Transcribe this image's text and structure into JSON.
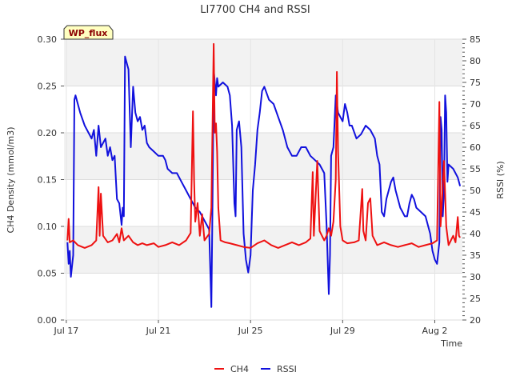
{
  "chart_data": {
    "type": "line",
    "title": "LI7700 CH4 and RSSI",
    "xlabel": "Time",
    "ylabel_left": "CH4 Density (mmol/m3)",
    "ylabel_right": "RSSI (%)",
    "badge": "WP_flux",
    "x_unit": "days since Jul 17",
    "xlim": [
      -0.1,
      17.2
    ],
    "ylim_left": [
      0.0,
      0.3
    ],
    "ylim_right": [
      20,
      85
    ],
    "x_ticks": [
      {
        "label": "Jul 17",
        "x": 0
      },
      {
        "label": "Jul 21",
        "x": 4
      },
      {
        "label": "Jul 25",
        "x": 8
      },
      {
        "label": "Jul 29",
        "x": 12
      },
      {
        "label": "Aug 2",
        "x": 16
      }
    ],
    "y_ticks_left": [
      "0.00",
      "0.05",
      "0.10",
      "0.15",
      "0.20",
      "0.25",
      "0.30"
    ],
    "y_ticks_right": [
      "20",
      "25",
      "30",
      "35",
      "40",
      "45",
      "50",
      "55",
      "60",
      "65",
      "70",
      "75",
      "80",
      "85"
    ],
    "legend": [
      {
        "name": "CH4",
        "color": "#ee1111"
      },
      {
        "name": "RSSI",
        "color": "#1111dd"
      }
    ],
    "series": [
      {
        "name": "CH4",
        "axis": "left",
        "color": "#ee1111",
        "points": [
          [
            0.05,
            0.085
          ],
          [
            0.1,
            0.108
          ],
          [
            0.15,
            0.083
          ],
          [
            0.3,
            0.085
          ],
          [
            0.5,
            0.08
          ],
          [
            0.8,
            0.077
          ],
          [
            1.1,
            0.08
          ],
          [
            1.3,
            0.085
          ],
          [
            1.4,
            0.142
          ],
          [
            1.45,
            0.09
          ],
          [
            1.5,
            0.135
          ],
          [
            1.6,
            0.09
          ],
          [
            1.8,
            0.083
          ],
          [
            2.0,
            0.085
          ],
          [
            2.2,
            0.092
          ],
          [
            2.3,
            0.083
          ],
          [
            2.4,
            0.098
          ],
          [
            2.5,
            0.085
          ],
          [
            2.7,
            0.09
          ],
          [
            2.9,
            0.083
          ],
          [
            3.1,
            0.08
          ],
          [
            3.3,
            0.082
          ],
          [
            3.5,
            0.08
          ],
          [
            3.8,
            0.082
          ],
          [
            4.0,
            0.078
          ],
          [
            4.3,
            0.08
          ],
          [
            4.6,
            0.083
          ],
          [
            4.9,
            0.08
          ],
          [
            5.2,
            0.085
          ],
          [
            5.4,
            0.093
          ],
          [
            5.5,
            0.223
          ],
          [
            5.55,
            0.15
          ],
          [
            5.6,
            0.105
          ],
          [
            5.7,
            0.125
          ],
          [
            5.8,
            0.09
          ],
          [
            5.9,
            0.113
          ],
          [
            6.0,
            0.085
          ],
          [
            6.2,
            0.092
          ],
          [
            6.3,
            0.12
          ],
          [
            6.4,
            0.295
          ],
          [
            6.45,
            0.2
          ],
          [
            6.5,
            0.21
          ],
          [
            6.55,
            0.18
          ],
          [
            6.6,
            0.12
          ],
          [
            6.7,
            0.085
          ],
          [
            6.9,
            0.083
          ],
          [
            7.1,
            0.082
          ],
          [
            7.4,
            0.08
          ],
          [
            7.7,
            0.078
          ],
          [
            8.0,
            0.077
          ],
          [
            8.3,
            0.082
          ],
          [
            8.6,
            0.085
          ],
          [
            8.9,
            0.08
          ],
          [
            9.2,
            0.077
          ],
          [
            9.5,
            0.08
          ],
          [
            9.8,
            0.083
          ],
          [
            10.1,
            0.08
          ],
          [
            10.4,
            0.083
          ],
          [
            10.6,
            0.087
          ],
          [
            10.7,
            0.158
          ],
          [
            10.75,
            0.09
          ],
          [
            10.9,
            0.17
          ],
          [
            11.0,
            0.095
          ],
          [
            11.2,
            0.085
          ],
          [
            11.3,
            0.09
          ],
          [
            11.4,
            0.098
          ],
          [
            11.5,
            0.09
          ],
          [
            11.6,
            0.105
          ],
          [
            11.7,
            0.15
          ],
          [
            11.75,
            0.265
          ],
          [
            11.8,
            0.18
          ],
          [
            11.9,
            0.1
          ],
          [
            12.0,
            0.085
          ],
          [
            12.2,
            0.082
          ],
          [
            12.5,
            0.083
          ],
          [
            12.7,
            0.085
          ],
          [
            12.85,
            0.14
          ],
          [
            12.9,
            0.095
          ],
          [
            13.0,
            0.085
          ],
          [
            13.1,
            0.125
          ],
          [
            13.2,
            0.13
          ],
          [
            13.3,
            0.09
          ],
          [
            13.5,
            0.08
          ],
          [
            13.8,
            0.083
          ],
          [
            14.1,
            0.08
          ],
          [
            14.4,
            0.078
          ],
          [
            14.7,
            0.08
          ],
          [
            15.0,
            0.082
          ],
          [
            15.3,
            0.078
          ],
          [
            15.6,
            0.08
          ],
          [
            15.9,
            0.082
          ],
          [
            16.1,
            0.085
          ],
          [
            16.2,
            0.233
          ],
          [
            16.25,
            0.1
          ],
          [
            16.3,
            0.12
          ],
          [
            16.4,
            0.17
          ],
          [
            16.5,
            0.1
          ],
          [
            16.6,
            0.08
          ],
          [
            16.7,
            0.085
          ],
          [
            16.8,
            0.09
          ],
          [
            16.9,
            0.083
          ],
          [
            17.0,
            0.11
          ],
          [
            17.05,
            0.09
          ],
          [
            17.1,
            0.088
          ]
        ]
      },
      {
        "name": "RSSI",
        "axis": "right",
        "color": "#1111dd",
        "points": [
          [
            0.05,
            38
          ],
          [
            0.1,
            33
          ],
          [
            0.15,
            36
          ],
          [
            0.2,
            30
          ],
          [
            0.3,
            35
          ],
          [
            0.35,
            71
          ],
          [
            0.4,
            72
          ],
          [
            0.6,
            68
          ],
          [
            0.8,
            65
          ],
          [
            1.1,
            62
          ],
          [
            1.2,
            64
          ],
          [
            1.3,
            58
          ],
          [
            1.4,
            65
          ],
          [
            1.5,
            60
          ],
          [
            1.7,
            62
          ],
          [
            1.8,
            58
          ],
          [
            1.9,
            60
          ],
          [
            2.0,
            57
          ],
          [
            2.1,
            58
          ],
          [
            2.2,
            48
          ],
          [
            2.3,
            47
          ],
          [
            2.4,
            42
          ],
          [
            2.45,
            46
          ],
          [
            2.5,
            44
          ],
          [
            2.55,
            81
          ],
          [
            2.6,
            80
          ],
          [
            2.7,
            78
          ],
          [
            2.8,
            60
          ],
          [
            2.9,
            74
          ],
          [
            3.0,
            68
          ],
          [
            3.1,
            66
          ],
          [
            3.2,
            67
          ],
          [
            3.3,
            64
          ],
          [
            3.4,
            65
          ],
          [
            3.5,
            61
          ],
          [
            3.6,
            60
          ],
          [
            3.8,
            59
          ],
          [
            4.0,
            58
          ],
          [
            4.2,
            58
          ],
          [
            4.3,
            57
          ],
          [
            4.4,
            55
          ],
          [
            4.6,
            54
          ],
          [
            4.8,
            54
          ],
          [
            5.0,
            52
          ],
          [
            5.2,
            50
          ],
          [
            5.4,
            48
          ],
          [
            5.6,
            46
          ],
          [
            5.8,
            45
          ],
          [
            6.0,
            43
          ],
          [
            6.2,
            41
          ],
          [
            6.3,
            23
          ],
          [
            6.35,
            48
          ],
          [
            6.4,
            78
          ],
          [
            6.45,
            75
          ],
          [
            6.5,
            72
          ],
          [
            6.55,
            76
          ],
          [
            6.6,
            74
          ],
          [
            6.8,
            75
          ],
          [
            7.0,
            74
          ],
          [
            7.1,
            72
          ],
          [
            7.2,
            65
          ],
          [
            7.3,
            47
          ],
          [
            7.35,
            44
          ],
          [
            7.4,
            64
          ],
          [
            7.5,
            66
          ],
          [
            7.6,
            60
          ],
          [
            7.7,
            40
          ],
          [
            7.8,
            34
          ],
          [
            7.9,
            31
          ],
          [
            8.0,
            35
          ],
          [
            8.1,
            50
          ],
          [
            8.2,
            56
          ],
          [
            8.3,
            64
          ],
          [
            8.4,
            68
          ],
          [
            8.5,
            73
          ],
          [
            8.6,
            74
          ],
          [
            8.8,
            71
          ],
          [
            9.0,
            70
          ],
          [
            9.2,
            67
          ],
          [
            9.4,
            64
          ],
          [
            9.6,
            60
          ],
          [
            9.8,
            58
          ],
          [
            10.0,
            58
          ],
          [
            10.2,
            60
          ],
          [
            10.4,
            60
          ],
          [
            10.6,
            58
          ],
          [
            10.8,
            57
          ],
          [
            11.0,
            56
          ],
          [
            11.2,
            54
          ],
          [
            11.3,
            42
          ],
          [
            11.4,
            26
          ],
          [
            11.45,
            35
          ],
          [
            11.5,
            58
          ],
          [
            11.6,
            60
          ],
          [
            11.7,
            72
          ],
          [
            11.8,
            68
          ],
          [
            11.9,
            67
          ],
          [
            12.0,
            66
          ],
          [
            12.1,
            70
          ],
          [
            12.2,
            68
          ],
          [
            12.3,
            65
          ],
          [
            12.4,
            65
          ],
          [
            12.6,
            62
          ],
          [
            12.8,
            63
          ],
          [
            13.0,
            65
          ],
          [
            13.2,
            64
          ],
          [
            13.4,
            62
          ],
          [
            13.5,
            58
          ],
          [
            13.6,
            56
          ],
          [
            13.7,
            45
          ],
          [
            13.8,
            44
          ],
          [
            13.9,
            48
          ],
          [
            14.0,
            50
          ],
          [
            14.1,
            52
          ],
          [
            14.2,
            53
          ],
          [
            14.3,
            50
          ],
          [
            14.4,
            48
          ],
          [
            14.5,
            46
          ],
          [
            14.6,
            45
          ],
          [
            14.7,
            44
          ],
          [
            14.8,
            44
          ],
          [
            14.9,
            47
          ],
          [
            15.0,
            49
          ],
          [
            15.1,
            48
          ],
          [
            15.2,
            46
          ],
          [
            15.4,
            45
          ],
          [
            15.6,
            44
          ],
          [
            15.7,
            42
          ],
          [
            15.8,
            40
          ],
          [
            15.9,
            36
          ],
          [
            16.0,
            34
          ],
          [
            16.1,
            33
          ],
          [
            16.2,
            38
          ],
          [
            16.25,
            67
          ],
          [
            16.3,
            64
          ],
          [
            16.35,
            44
          ],
          [
            16.4,
            50
          ],
          [
            16.45,
            72
          ],
          [
            16.5,
            68
          ],
          [
            16.55,
            52
          ],
          [
            16.6,
            56
          ],
          [
            16.8,
            55
          ],
          [
            17.0,
            53
          ],
          [
            17.1,
            51
          ]
        ]
      }
    ]
  }
}
